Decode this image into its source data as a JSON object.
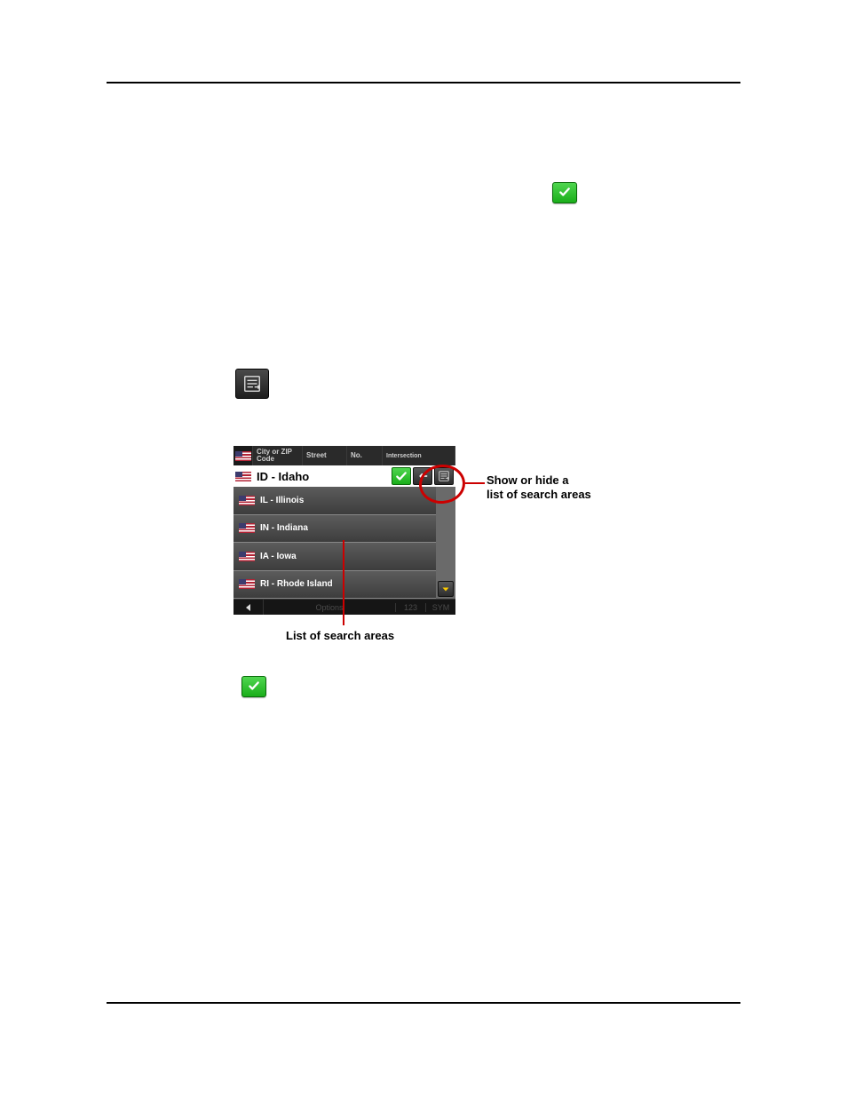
{
  "device": {
    "tabs": {
      "city": "City or ZIP Code",
      "street": "Street",
      "no": "No.",
      "intersection": "Intersection"
    },
    "selected": {
      "label": "ID - Idaho"
    },
    "list": [
      {
        "label": "IL - Illinois"
      },
      {
        "label": "IN - Indiana"
      },
      {
        "label": "IA - Iowa"
      },
      {
        "label": "RI - Rhode Island"
      }
    ],
    "bottom": {
      "options": "Options",
      "key123": "123",
      "keySym": "SYM"
    }
  },
  "annotations": {
    "right_line1": "Show or hide a",
    "right_line2": "list of search areas",
    "bottom": "List of search areas"
  },
  "icons": {
    "check": "check-icon",
    "list": "list-icon",
    "back": "back-icon",
    "arrow_down": "arrow-down-icon",
    "arrow_left": "arrow-left-icon",
    "us_flag": "us-flag-icon"
  }
}
